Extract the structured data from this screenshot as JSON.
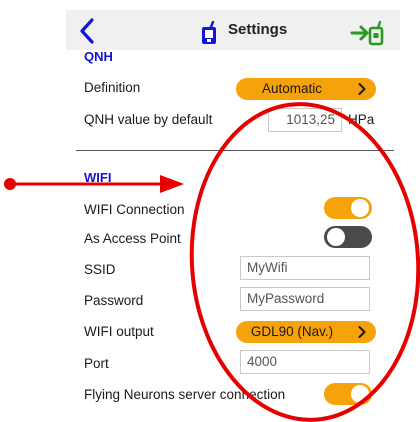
{
  "header": {
    "title": "Settings",
    "back_icon": "chevron-left-icon",
    "device_icon": "device-icon",
    "exit_icon": "exit-to-device-icon",
    "accent_color": "#1414d8",
    "exit_color": "#2a9a1e"
  },
  "qnh": {
    "section_title": "QNH",
    "definition_label": "Definition",
    "definition_value": "Automatic",
    "default_label": "QNH value by default",
    "default_value": "1013,25",
    "default_unit": "HPa"
  },
  "wifi": {
    "section_title": "WIFI",
    "connection_label": "WIFI Connection",
    "connection_on": true,
    "access_point_label": "As Access Point",
    "access_point_on": false,
    "ssid_label": "SSID",
    "ssid_value": "MyWifi",
    "password_label": "Password",
    "password_value": "MyPassword",
    "output_label": "WIFI output",
    "output_value": "GDL90 (Nav.)",
    "port_label": "Port",
    "port_value": "4000",
    "server_label": "Flying Neurons server connection",
    "server_on": true
  },
  "theme": {
    "toggle_on_color": "#f6a20a",
    "toggle_off_color": "#4a4a4a",
    "annotation_color": "#e60000"
  }
}
